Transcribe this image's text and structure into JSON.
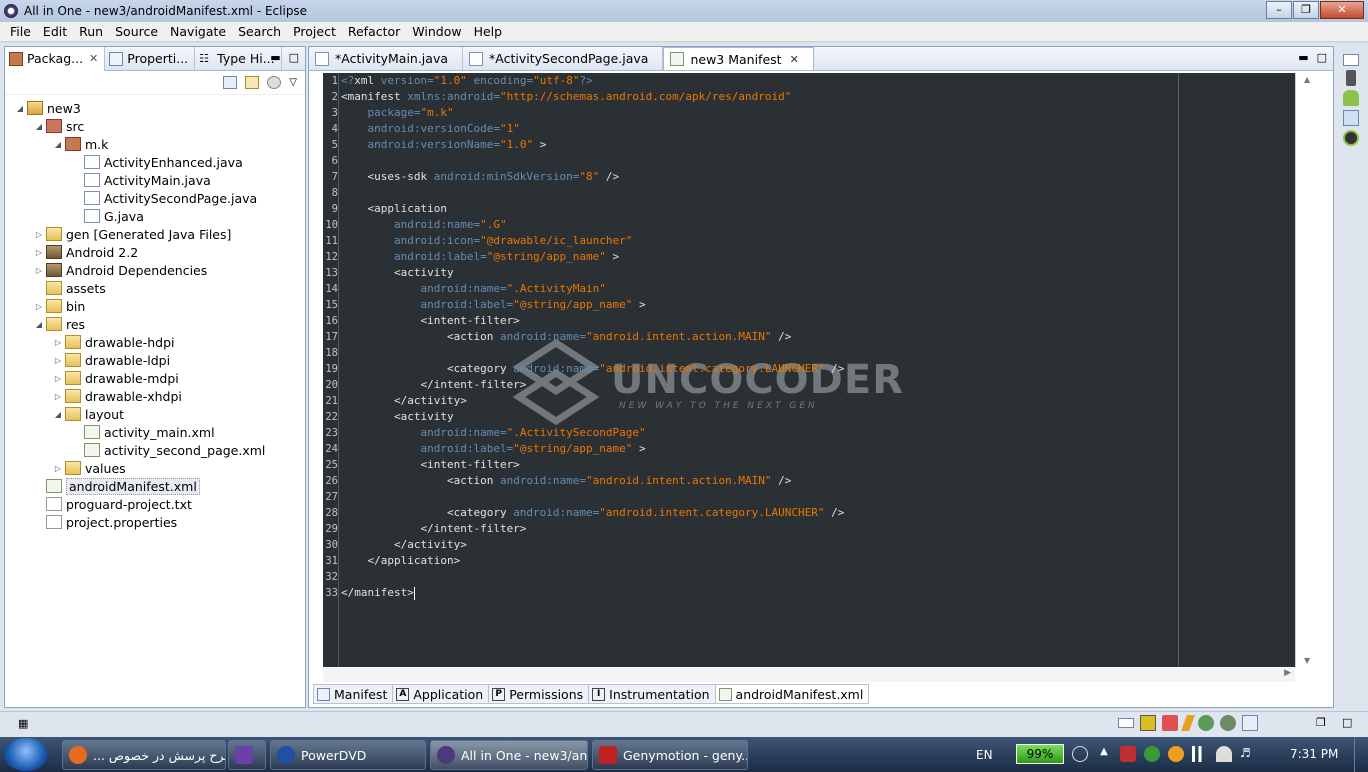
{
  "window": {
    "title": "All in One - new3/androidManifest.xml - Eclipse"
  },
  "menu": [
    "File",
    "Edit",
    "Run",
    "Source",
    "Navigate",
    "Search",
    "Project",
    "Refactor",
    "Window",
    "Help"
  ],
  "left_tabs": [
    {
      "label": "Packag...",
      "active": true,
      "closable": true
    },
    {
      "label": "Properti...",
      "active": false,
      "closable": false
    },
    {
      "label": "Type Hi...",
      "active": false,
      "closable": false
    }
  ],
  "tree": [
    {
      "label": "new3",
      "depth": 0,
      "icon": "project-icon",
      "expanded": true
    },
    {
      "label": "src",
      "depth": 1,
      "icon": "source-folder-icon",
      "expanded": true
    },
    {
      "label": "m.k",
      "depth": 2,
      "icon": "package-icon",
      "expanded": true
    },
    {
      "label": "ActivityEnhanced.java",
      "depth": 3,
      "icon": "java-file-icon"
    },
    {
      "label": "ActivityMain.java",
      "depth": 3,
      "icon": "java-file-icon"
    },
    {
      "label": "ActivitySecondPage.java",
      "depth": 3,
      "icon": "java-file-icon"
    },
    {
      "label": "G.java",
      "depth": 3,
      "icon": "java-file-icon"
    },
    {
      "label": "gen [Generated Java Files]",
      "depth": 1,
      "icon": "folder-icon",
      "expanded": false
    },
    {
      "label": "Android 2.2",
      "depth": 1,
      "icon": "library-icon",
      "expanded": false
    },
    {
      "label": "Android Dependencies",
      "depth": 1,
      "icon": "library-icon",
      "expanded": false
    },
    {
      "label": "assets",
      "depth": 1,
      "icon": "folder-icon"
    },
    {
      "label": "bin",
      "depth": 1,
      "icon": "folder-icon",
      "expanded": false
    },
    {
      "label": "res",
      "depth": 1,
      "icon": "folder-icon",
      "expanded": true
    },
    {
      "label": "drawable-hdpi",
      "depth": 2,
      "icon": "folder-icon",
      "expanded": false
    },
    {
      "label": "drawable-ldpi",
      "depth": 2,
      "icon": "folder-icon",
      "expanded": false
    },
    {
      "label": "drawable-mdpi",
      "depth": 2,
      "icon": "folder-icon",
      "expanded": false
    },
    {
      "label": "drawable-xhdpi",
      "depth": 2,
      "icon": "folder-icon",
      "expanded": false
    },
    {
      "label": "layout",
      "depth": 2,
      "icon": "folder-icon",
      "expanded": true
    },
    {
      "label": "activity_main.xml",
      "depth": 3,
      "icon": "xml-file-icon"
    },
    {
      "label": "activity_second_page.xml",
      "depth": 3,
      "icon": "xml-file-icon"
    },
    {
      "label": "values",
      "depth": 2,
      "icon": "folder-icon",
      "expanded": false
    },
    {
      "label": "androidManifest.xml",
      "depth": 1,
      "icon": "xml-file-icon",
      "selected": true
    },
    {
      "label": "proguard-project.txt",
      "depth": 1,
      "icon": "text-file-icon"
    },
    {
      "label": "project.properties",
      "depth": 1,
      "icon": "text-file-icon"
    }
  ],
  "editor_tabs": [
    {
      "label": "*ActivityMain.java",
      "active": false
    },
    {
      "label": "*ActivitySecondPage.java",
      "active": false
    },
    {
      "label": "new3 Manifest",
      "active": true
    }
  ],
  "code_lines": [
    [
      [
        "pi",
        "<?"
      ],
      [
        "tag",
        "xml "
      ],
      [
        "attr",
        "version="
      ],
      [
        "val",
        "\"1.0\""
      ],
      [
        "tag",
        " "
      ],
      [
        "attr",
        "encoding="
      ],
      [
        "val",
        "\"utf-8\""
      ],
      [
        "pi",
        "?>"
      ]
    ],
    [
      [
        "tag",
        "<manifest "
      ],
      [
        "attr",
        "xmlns:android="
      ],
      [
        "val",
        "\"http://schemas.android.com/apk/res/android\""
      ]
    ],
    [
      [
        "tag",
        "    "
      ],
      [
        "attr",
        "package="
      ],
      [
        "val",
        "\"m.k\""
      ]
    ],
    [
      [
        "tag",
        "    "
      ],
      [
        "attr",
        "android:versionCode="
      ],
      [
        "val",
        "\"1\""
      ]
    ],
    [
      [
        "tag",
        "    "
      ],
      [
        "attr",
        "android:versionName="
      ],
      [
        "val",
        "\"1.0\""
      ],
      [
        "tag",
        " >"
      ]
    ],
    [],
    [
      [
        "tag",
        "    <uses-sdk "
      ],
      [
        "attr",
        "android:minSdkVersion="
      ],
      [
        "val",
        "\"8\""
      ],
      [
        "tag",
        " />"
      ]
    ],
    [],
    [
      [
        "tag",
        "    <application"
      ]
    ],
    [
      [
        "tag",
        "        "
      ],
      [
        "attr",
        "android:name="
      ],
      [
        "val",
        "\".G\""
      ]
    ],
    [
      [
        "tag",
        "        "
      ],
      [
        "attr",
        "android:icon="
      ],
      [
        "val",
        "\"@drawable/ic_launcher\""
      ]
    ],
    [
      [
        "tag",
        "        "
      ],
      [
        "attr",
        "android:label="
      ],
      [
        "val",
        "\"@string/app_name\""
      ],
      [
        "tag",
        " >"
      ]
    ],
    [
      [
        "tag",
        "        <activity"
      ]
    ],
    [
      [
        "tag",
        "            "
      ],
      [
        "attr",
        "android:name="
      ],
      [
        "val",
        "\".ActivityMain\""
      ]
    ],
    [
      [
        "tag",
        "            "
      ],
      [
        "attr",
        "android:label="
      ],
      [
        "val",
        "\"@string/app_name\""
      ],
      [
        "tag",
        " >"
      ]
    ],
    [
      [
        "tag",
        "            <intent-filter>"
      ]
    ],
    [
      [
        "tag",
        "                <action "
      ],
      [
        "attr",
        "android:name="
      ],
      [
        "val",
        "\"android.intent.action.MAIN\""
      ],
      [
        "tag",
        " />"
      ]
    ],
    [],
    [
      [
        "tag",
        "                <category "
      ],
      [
        "attr",
        "android:name="
      ],
      [
        "val",
        "\"android.intent.category.LAUNCHER\""
      ],
      [
        "tag",
        " />"
      ]
    ],
    [
      [
        "tag",
        "            </intent-filter>"
      ]
    ],
    [
      [
        "tag",
        "        </activity>"
      ]
    ],
    [
      [
        "tag",
        "        <activity"
      ]
    ],
    [
      [
        "tag",
        "            "
      ],
      [
        "attr",
        "android:name="
      ],
      [
        "val",
        "\".ActivitySecondPage\""
      ]
    ],
    [
      [
        "tag",
        "            "
      ],
      [
        "attr",
        "android:label="
      ],
      [
        "val",
        "\"@string/app_name\""
      ],
      [
        "tag",
        " >"
      ]
    ],
    [
      [
        "tag",
        "            <intent-filter>"
      ]
    ],
    [
      [
        "tag",
        "                <action "
      ],
      [
        "attr",
        "android:name="
      ],
      [
        "val",
        "\"android.intent.action.MAIN\""
      ],
      [
        "tag",
        " />"
      ]
    ],
    [],
    [
      [
        "tag",
        "                <category "
      ],
      [
        "attr",
        "android:name="
      ],
      [
        "val",
        "\"android.intent.category.LAUNCHER\""
      ],
      [
        "tag",
        " />"
      ]
    ],
    [
      [
        "tag",
        "            </intent-filter>"
      ]
    ],
    [
      [
        "tag",
        "        </activity>"
      ]
    ],
    [
      [
        "tag",
        "    </application>"
      ]
    ],
    [],
    [
      [
        "tag",
        "</manifest>"
      ]
    ]
  ],
  "watermark": {
    "title": "UNCOCODER",
    "subtitle": "NEW WAY TO THE NEXT GEN"
  },
  "bottom_tabs": [
    {
      "label": "Manifest",
      "icon": "manifest-icon"
    },
    {
      "label": "Application",
      "icon": "A"
    },
    {
      "label": "Permissions",
      "icon": "P"
    },
    {
      "label": "Instrumentation",
      "icon": "I"
    },
    {
      "label": "androidManifest.xml",
      "icon": "xml-file-icon",
      "active": true
    }
  ],
  "taskbar": {
    "buttons": [
      {
        "label": "... طرح پرسش در خصوص",
        "icon": "firefox-icon",
        "color": "#e66b1f"
      },
      {
        "label": "",
        "icon": "visual-studio-icon",
        "color": "#6a3fa8"
      },
      {
        "label": "PowerDVD",
        "icon": "powerdvd-icon",
        "color": "#2050a0"
      },
      {
        "label": "All in One - new3/an...",
        "icon": "eclipse-icon",
        "color": "#4b3a7a",
        "active": true
      },
      {
        "label": "Genymotion - geny...",
        "icon": "genymotion-icon",
        "color": "#c02020"
      }
    ],
    "language": "EN",
    "battery": "99%",
    "clock": "7:31 PM"
  }
}
